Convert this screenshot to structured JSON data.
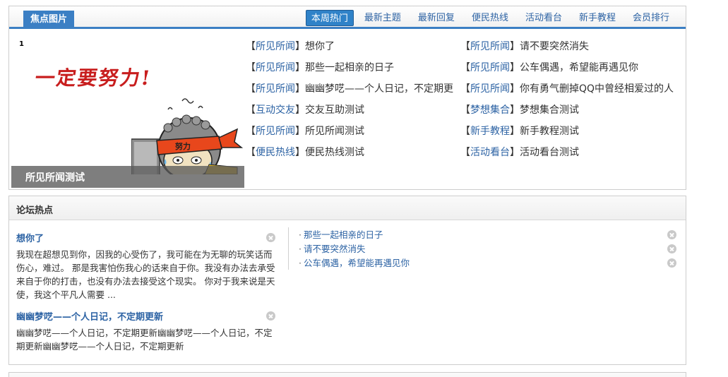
{
  "focus": {
    "title": "焦点图片",
    "tabs": [
      {
        "label": "本周热门",
        "active": true
      },
      {
        "label": "最新主题"
      },
      {
        "label": "最新回复"
      },
      {
        "label": "便民热线"
      },
      {
        "label": "活动看台"
      },
      {
        "label": "新手教程"
      },
      {
        "label": "会员排行"
      }
    ],
    "slide": {
      "number": "1",
      "slogan": "一定要努力!",
      "headband_text": "努力",
      "caption": "所见所闻测试"
    },
    "left_list": [
      {
        "category": "所见所闻",
        "title": "想你了"
      },
      {
        "category": "所见所闻",
        "title": "那些一起相亲的日子"
      },
      {
        "category": "所见所闻",
        "title": "幽幽梦呓——个人日记，不定期更"
      },
      {
        "category": "互动交友",
        "title": "交友互助测试"
      },
      {
        "category": "所见所闻",
        "title": "所见所闻测试"
      },
      {
        "category": "便民热线",
        "title": "便民热线测试"
      }
    ],
    "right_list": [
      {
        "category": "所见所闻",
        "title": "请不要突然消失"
      },
      {
        "category": "所见所闻",
        "title": "公车偶遇，希望能再遇见你"
      },
      {
        "category": "所见所闻",
        "title": "你有勇气删掉QQ中曾经相爱过的人"
      },
      {
        "category": "梦想集合",
        "title": "梦想集合测试"
      },
      {
        "category": "新手教程",
        "title": "新手教程测试"
      },
      {
        "category": "活动看台",
        "title": "活动看台测试"
      }
    ],
    "bracket_open": "【",
    "bracket_close": "】"
  },
  "hot": {
    "title": "论坛热点",
    "articles": [
      {
        "title": "想你了",
        "summary": "我现在超想见到你，因我的心受伤了，我可能在为无聊的玩笑话而伤心，难过。 那是我害怕伤我心的话来自于你。我没有办法去承受来自于你的打击，也没有办法去接受这个现实。 你对于我来说是天使，我这个平凡人需要 ..."
      },
      {
        "title": "幽幽梦呓——个人日记，不定期更新",
        "summary": "幽幽梦呓——个人日记，不定期更新幽幽梦呓——个人日记，不定期更新幽幽梦呓——个人日记，不定期更新"
      }
    ],
    "links": [
      {
        "bullet": "·",
        "title": "那些一起相亲的日子"
      },
      {
        "bullet": "·",
        "title": "请不要突然消失"
      },
      {
        "bullet": "·",
        "title": "公车偶遇，希望能再遇见你"
      }
    ]
  },
  "colors": {
    "accent_blue": "#3b7fc4",
    "link_blue": "#2d63a4",
    "slogan_red": "#c81e1e",
    "headband_orange": "#e8471c"
  }
}
